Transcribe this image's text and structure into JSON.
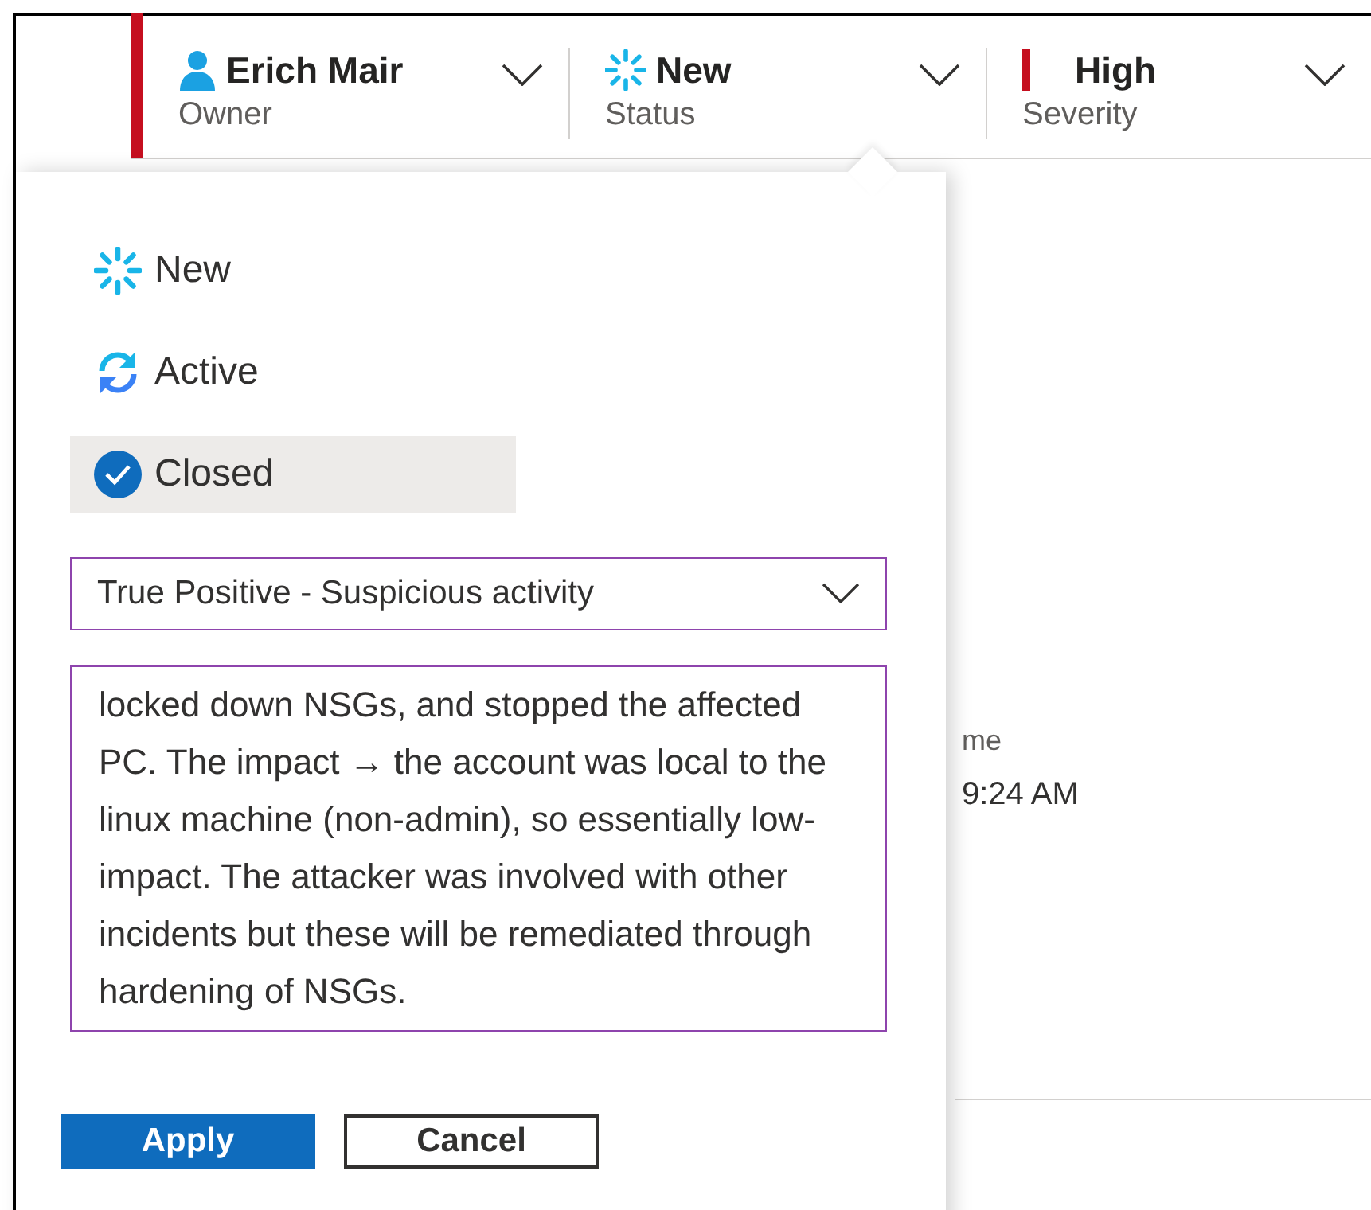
{
  "header": {
    "fields": [
      {
        "kind": "owner",
        "value": "Erich Mair",
        "label": "Owner"
      },
      {
        "kind": "status",
        "value": "New",
        "label": "Status"
      },
      {
        "kind": "severity",
        "value": "High",
        "label": "Severity"
      }
    ]
  },
  "status_menu": {
    "options": [
      {
        "kind": "new",
        "label": "New",
        "selected": false
      },
      {
        "kind": "active",
        "label": "Active",
        "selected": false
      },
      {
        "kind": "closed",
        "label": "Closed",
        "selected": true
      }
    ],
    "classification": {
      "value": "True Positive - Suspicious activity"
    },
    "comment": {
      "value": "locked down NSGs, and stopped the affected PC. The impact → the account was local to the linux machine (non-admin), so essentially low-impact. The attacker was involved with other incidents but these will be remediated through hardening of NSGs."
    },
    "buttons": [
      {
        "kind": "primary",
        "label": "Apply"
      },
      {
        "kind": "secondary",
        "label": "Cancel"
      }
    ]
  },
  "background": {
    "field_label": "me",
    "field_value": "9:24 AM"
  }
}
